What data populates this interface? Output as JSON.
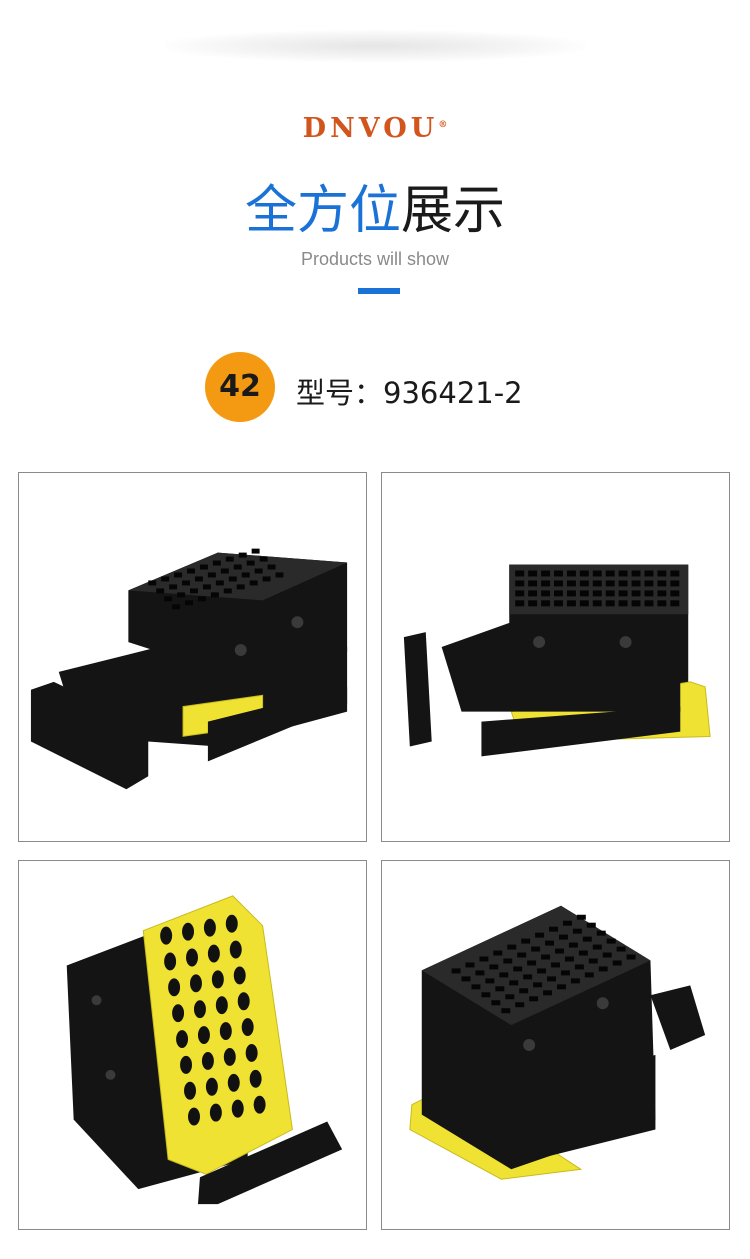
{
  "brand": {
    "name": "DNVOU",
    "mark": "®",
    "color": "#d2551e"
  },
  "heading": {
    "blue_part": "全方位",
    "black_part": "展示",
    "subtitle": "Products will show",
    "accent": "#1b72d6"
  },
  "model": {
    "number": "42",
    "label": "型号：",
    "value": "936421-2",
    "badge_color": "#f39a12"
  },
  "photos": [
    {
      "name": "connector-side-left-view"
    },
    {
      "name": "connector-side-right-view"
    },
    {
      "name": "connector-rear-yellow-seal-view"
    },
    {
      "name": "connector-front-angled-view"
    }
  ],
  "colors": {
    "plastic": "#141414",
    "seal": "#f0e233",
    "seal_dark": "#c8bb1d"
  }
}
